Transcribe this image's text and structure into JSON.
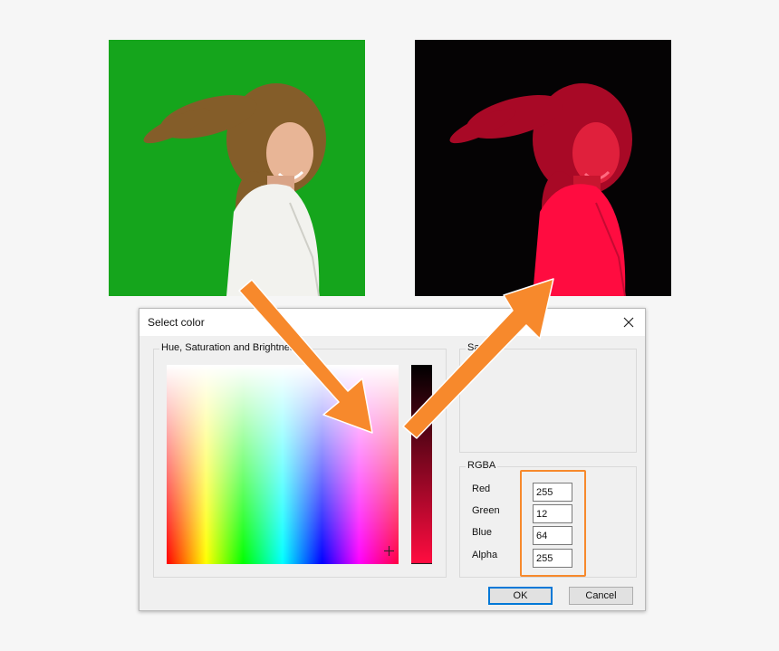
{
  "before_image": {
    "background_color": "#15a51c"
  },
  "after_image": {
    "background_color": "#050304",
    "tint_color": "#ff0c40"
  },
  "dialog": {
    "title": "Select color",
    "close_label": "×",
    "hsb_group_label": "Hue, Saturation and Brightness",
    "sample_group_label": "Sample",
    "rgba_group_label": "RGBA",
    "rgba": {
      "red_label": "Red",
      "red_value": "255",
      "green_label": "Green",
      "green_value": "12",
      "blue_label": "Blue",
      "blue_value": "64",
      "alpha_label": "Alpha",
      "alpha_value": "255"
    },
    "ok_label": "OK",
    "cancel_label": "Cancel"
  },
  "annotations": {
    "arrow_color": "#f7892c",
    "highlight_color": "#f7892c"
  }
}
